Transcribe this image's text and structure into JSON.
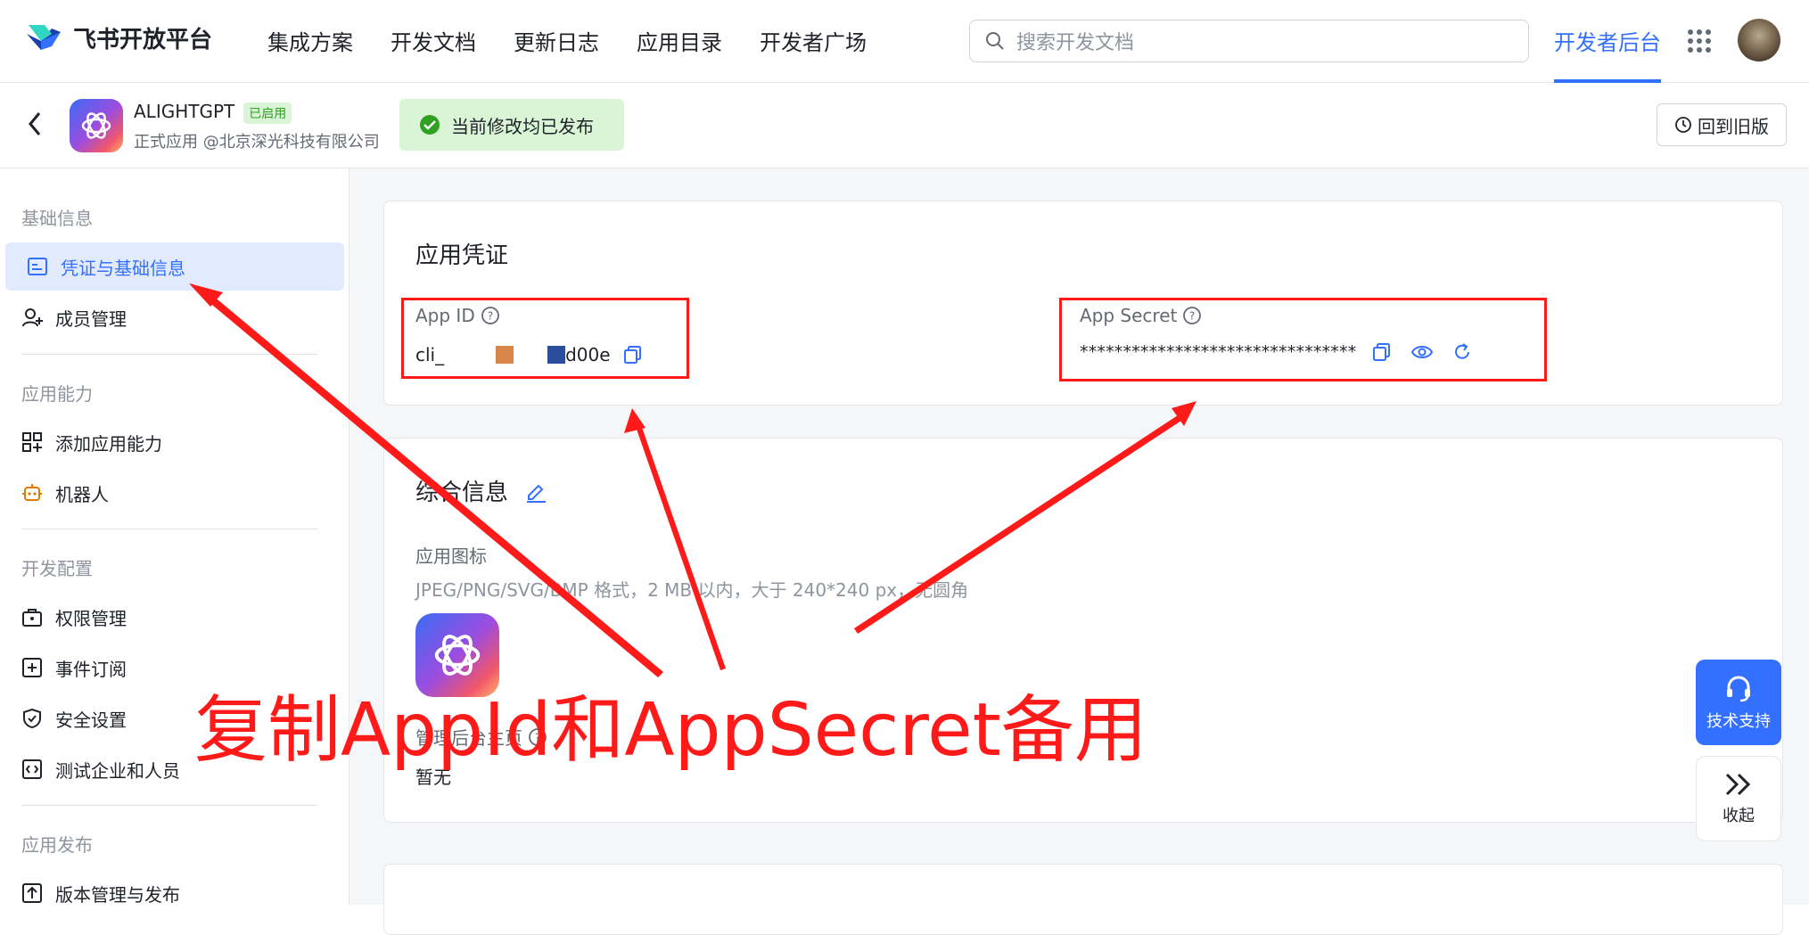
{
  "header": {
    "logo_text": "飞书开放平台",
    "nav": [
      "集成方案",
      "开发文档",
      "更新日志",
      "应用目录",
      "开发者广场"
    ],
    "search_placeholder": "搜索开发文档",
    "dev_console": "开发者后台"
  },
  "app": {
    "name": "ALIGHTGPT",
    "status": "已启用",
    "org": "正式应用 @北京深光科技有限公司",
    "publish_status": "当前修改均已发布",
    "old_version": "回到旧版"
  },
  "sidebar": {
    "sections": [
      {
        "title": "基础信息",
        "items": [
          "凭证与基础信息",
          "成员管理"
        ]
      },
      {
        "title": "应用能力",
        "items": [
          "添加应用能力",
          "机器人"
        ]
      },
      {
        "title": "开发配置",
        "items": [
          "权限管理",
          "事件订阅",
          "安全设置",
          "测试企业和人员"
        ]
      },
      {
        "title": "应用发布",
        "items": [
          "版本管理与发布"
        ]
      }
    ],
    "active": "凭证与基础信息"
  },
  "credentials": {
    "title": "应用凭证",
    "app_id_label": "App ID",
    "app_id_prefix": "cli_",
    "app_id_suffix": "d00e",
    "app_secret_label": "App Secret",
    "app_secret_value": "********************************"
  },
  "general": {
    "title": "综合信息",
    "icon_label": "应用图标",
    "icon_hint": "JPEG/PNG/SVG/BMP 格式，2 MB 以内，大于 240*240 px，无圆角",
    "homepage_label": "管理后台主页",
    "homepage_value": "暂无"
  },
  "floating": {
    "support": "技术支持",
    "collapse": "收起"
  },
  "annotation": "复制AppId和AppSecret备用",
  "colors": {
    "accent": "#3370ff",
    "annotation": "#ff1a1a",
    "success": "#2ea121"
  }
}
